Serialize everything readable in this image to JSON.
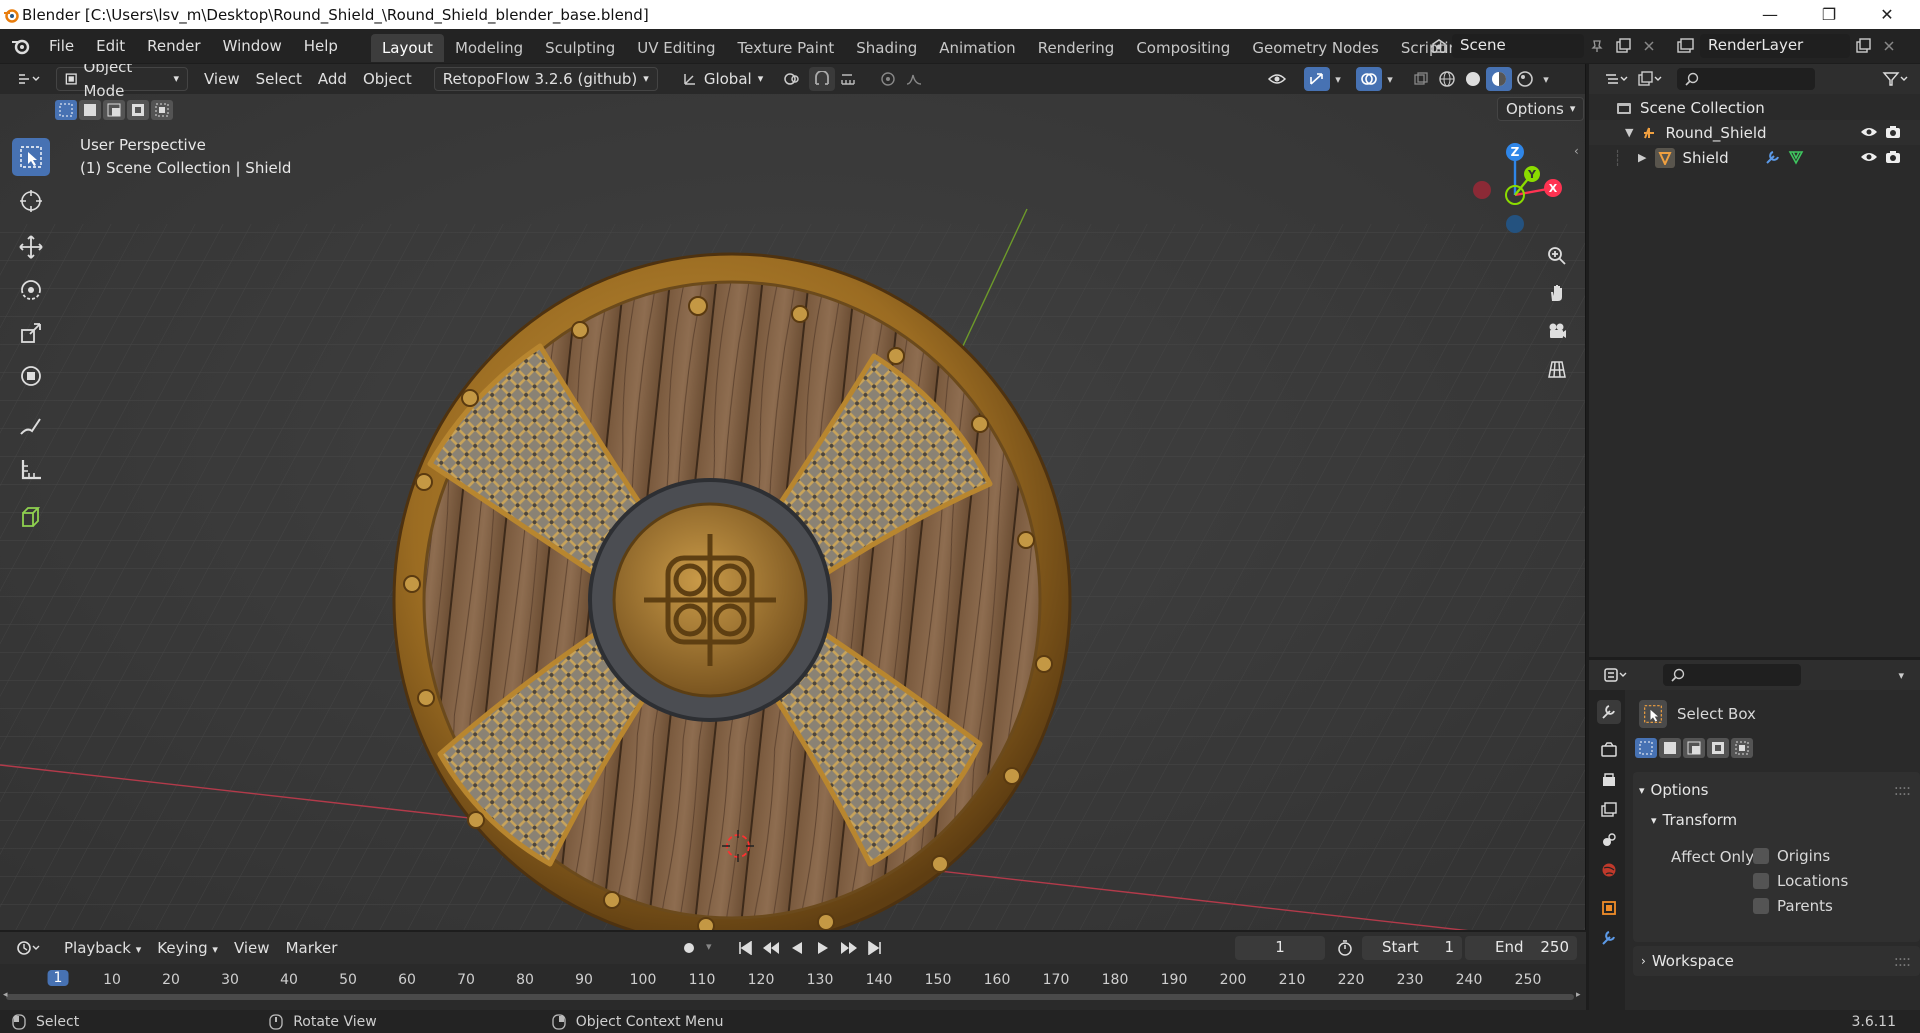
{
  "window": {
    "title": "Blender [C:\\Users\\lsv_m\\Desktop\\Round_Shield_\\Round_Shield_blender_base.blend]",
    "minimize": "—",
    "maximize": "❐",
    "close": "✕"
  },
  "menus": [
    "File",
    "Edit",
    "Render",
    "Window",
    "Help"
  ],
  "workspaces": [
    "Layout",
    "Modeling",
    "Sculpting",
    "UV Editing",
    "Texture Paint",
    "Shading",
    "Animation",
    "Rendering",
    "Compositing",
    "Geometry Nodes",
    "Scripting"
  ],
  "active_workspace": "Layout",
  "add_workspace": "+",
  "scene": "Scene",
  "render_layer": "RenderLayer",
  "viewport_header": {
    "mode": "Object Mode",
    "menus": [
      "View",
      "Select",
      "Add",
      "Object"
    ],
    "addon": "RetopoFlow 3.2.6 (github)",
    "orientation": "Global",
    "options": "Options"
  },
  "viewport_overlay": {
    "line1": "User Perspective",
    "line2": "(1) Scene Collection | Shield"
  },
  "gizmo": {
    "z": "Z",
    "y": "Y",
    "x": "X"
  },
  "outliner": {
    "root": "Scene Collection",
    "items": [
      {
        "label": "Round_Shield",
        "level": 1,
        "expanded": true
      },
      {
        "label": "Shield",
        "level": 2,
        "expanded": false
      }
    ]
  },
  "properties": {
    "tool_name": "Select Box",
    "sections": {
      "options": "Options",
      "transform": "Transform",
      "affect_only": "Affect Only",
      "workspace": "Workspace"
    },
    "checkboxes": [
      {
        "label": "Origins",
        "checked": false
      },
      {
        "label": "Locations",
        "checked": false
      },
      {
        "label": "Parents",
        "checked": false
      }
    ]
  },
  "timeline": {
    "menus": [
      "Playback",
      "Keying",
      "View",
      "Marker"
    ],
    "current_frame": "1",
    "start_label": "Start",
    "start": "1",
    "end_label": "End",
    "end": "250",
    "ticks": [
      "1",
      "10",
      "20",
      "30",
      "40",
      "50",
      "60",
      "70",
      "80",
      "90",
      "100",
      "110",
      "120",
      "130",
      "140",
      "150",
      "160",
      "170",
      "180",
      "190",
      "200",
      "210",
      "220",
      "230",
      "240",
      "250"
    ]
  },
  "statusbar": {
    "select": "Select",
    "rotate": "Rotate View",
    "context": "Object Context Menu",
    "version": "3.6.11"
  },
  "colors": {
    "accent": "#4772b3",
    "x_axis": "#ff3352",
    "y_axis": "#8bdc00",
    "z_axis": "#2f86e8"
  }
}
